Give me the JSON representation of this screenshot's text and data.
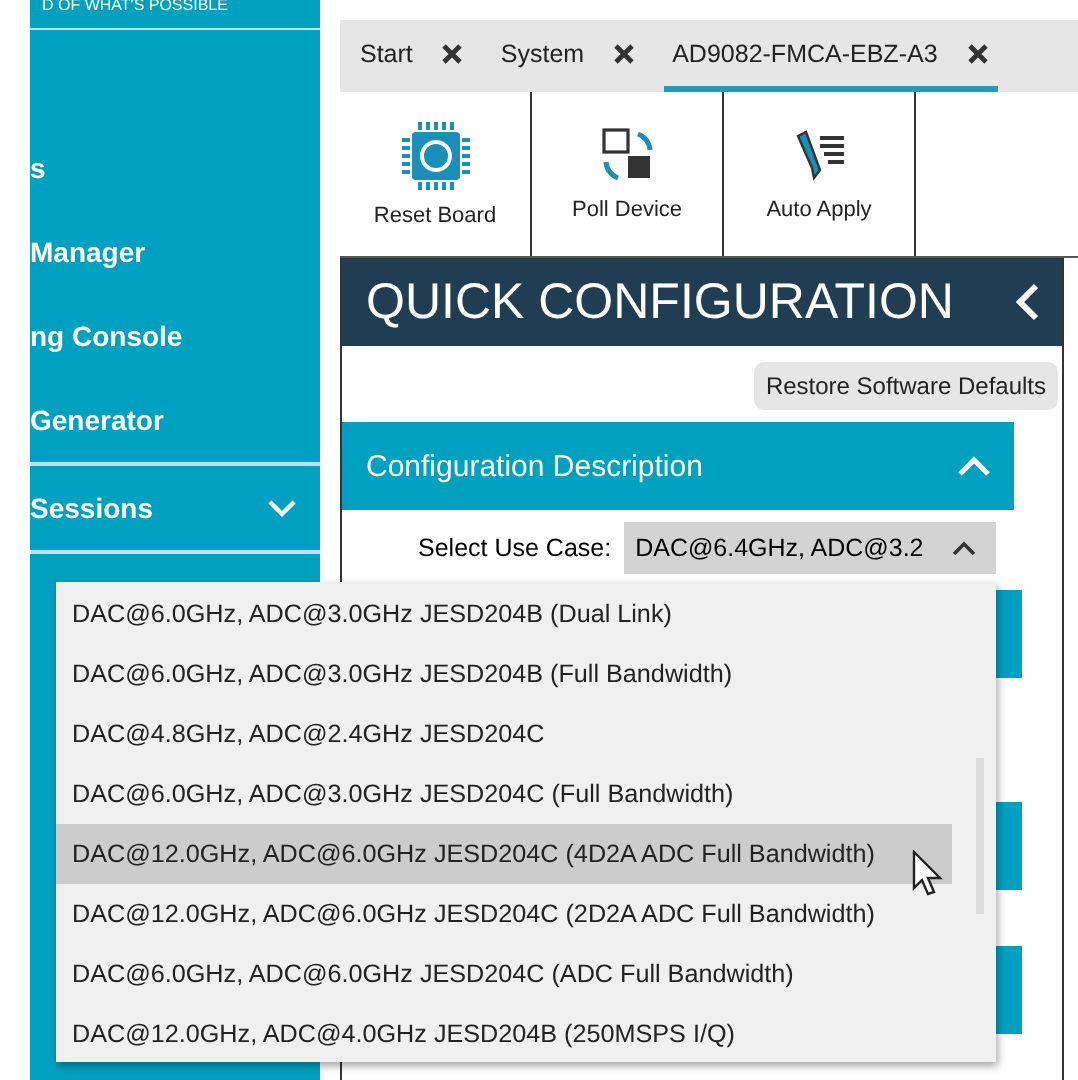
{
  "sidebar": {
    "tagline": "D OF WHAT'S POSSIBLE",
    "items": [
      {
        "label": "s",
        "expandable": false
      },
      {
        "label": "Manager",
        "expandable": false
      },
      {
        "label": "ng Console",
        "expandable": false
      },
      {
        "label": "Generator",
        "expandable": false
      },
      {
        "label": "Sessions",
        "expandable": true
      }
    ]
  },
  "tabs": [
    {
      "label": "Start",
      "selected": false
    },
    {
      "label": "System",
      "selected": false
    },
    {
      "label": "AD9082-FMCA-EBZ-A3",
      "selected": true
    }
  ],
  "toolbar": [
    {
      "label": "Reset Board",
      "kind": "chip"
    },
    {
      "label": "Poll Device",
      "kind": "poll"
    },
    {
      "label": "Auto Apply",
      "kind": "pen"
    }
  ],
  "panel": {
    "title": "QUICK CONFIGURATION",
    "restore_button": "Restore Software Defaults",
    "section": {
      "title": "Configuration Description",
      "expanded": true
    },
    "use_case": {
      "label": "Select Use Case:",
      "value": "DAC@6.4GHz, ADC@3.2",
      "open": true,
      "options": [
        {
          "label": "DAC@6.0GHz, ADC@3.0GHz JESD204B (Dual Link)",
          "hovered": false
        },
        {
          "label": "DAC@6.0GHz, ADC@3.0GHz JESD204B (Full Bandwidth)",
          "hovered": false
        },
        {
          "label": "DAC@4.8GHz, ADC@2.4GHz JESD204C",
          "hovered": false
        },
        {
          "label": "DAC@6.0GHz, ADC@3.0GHz JESD204C (Full Bandwidth)",
          "hovered": false
        },
        {
          "label": "DAC@12.0GHz, ADC@6.0GHz JESD204C (4D2A ADC Full Bandwidth)",
          "hovered": true
        },
        {
          "label": "DAC@12.0GHz, ADC@6.0GHz JESD204C (2D2A ADC Full Bandwidth)",
          "hovered": false
        },
        {
          "label": "DAC@6.0GHz, ADC@6.0GHz JESD204C (ADC Full Bandwidth)",
          "hovered": false
        },
        {
          "label": "DAC@12.0GHz, ADC@4.0GHz JESD204B (250MSPS I/Q)",
          "hovered": false
        }
      ]
    }
  }
}
